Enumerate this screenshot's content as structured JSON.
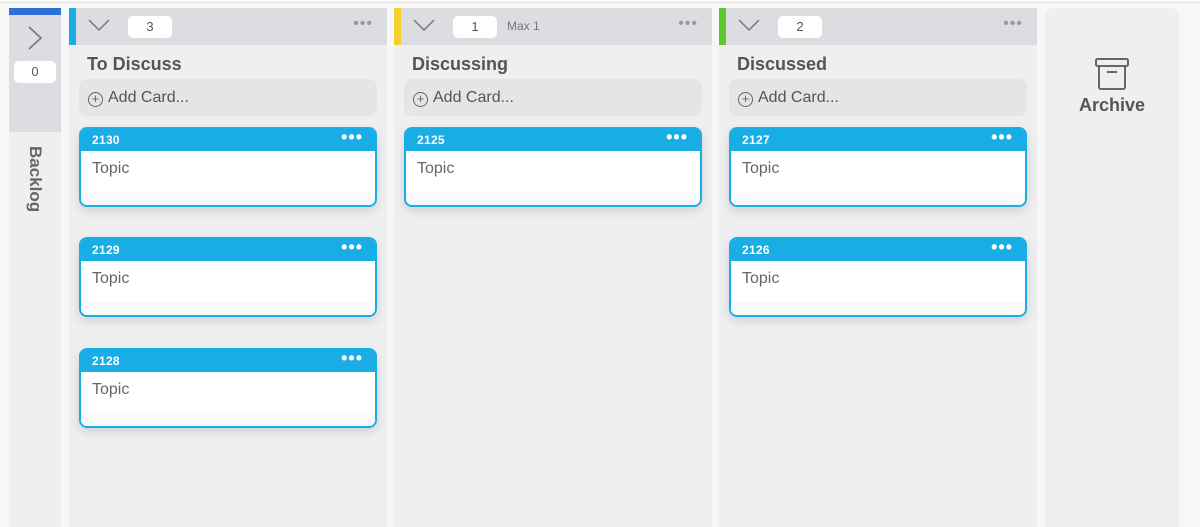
{
  "backlog": {
    "count": "0",
    "label": "Backlog",
    "accent": "#2f6fd6"
  },
  "columns": [
    {
      "title": "To Discuss",
      "count": "3",
      "max": "",
      "accent": "#18ade5",
      "add_label": "Add Card...",
      "cards": [
        {
          "id": "2130",
          "text": "Topic"
        },
        {
          "id": "2129",
          "text": "Topic"
        },
        {
          "id": "2128",
          "text": "Topic"
        }
      ]
    },
    {
      "title": "Discussing",
      "count": "1",
      "max": "Max 1",
      "accent": "#f5cf2b",
      "add_label": "Add Card...",
      "cards": [
        {
          "id": "2125",
          "text": "Topic"
        }
      ]
    },
    {
      "title": "Discussed",
      "count": "2",
      "max": "",
      "accent": "#5dc92f",
      "add_label": "Add Card...",
      "cards": [
        {
          "id": "2127",
          "text": "Topic"
        },
        {
          "id": "2126",
          "text": "Topic"
        }
      ]
    }
  ],
  "archive": {
    "label": "Archive"
  },
  "icons": {
    "more": "•••",
    "collapse": "chevron-down",
    "expand": "chevron-right",
    "add": "+"
  },
  "colors": {
    "card": "#18ade5"
  }
}
